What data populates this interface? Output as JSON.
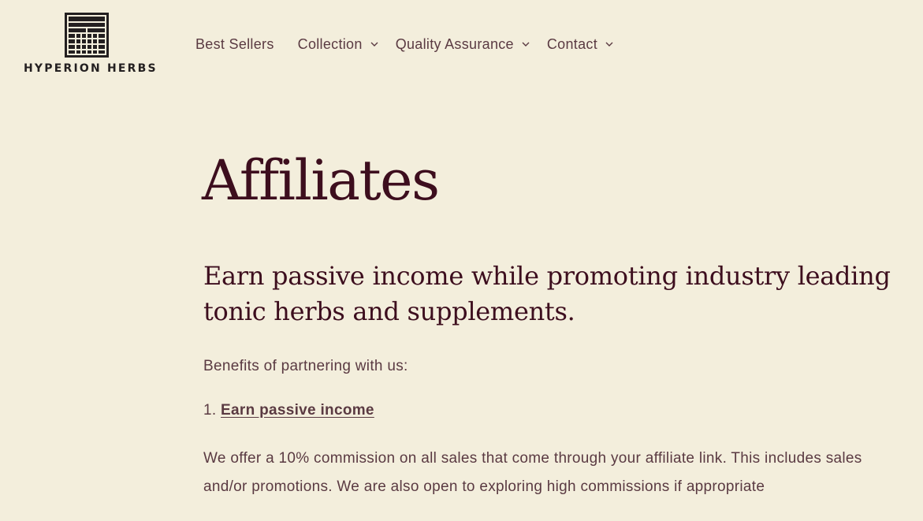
{
  "brand": {
    "name": "HYPERION HERBS",
    "logo_icon": "barcode-grid-logo-icon"
  },
  "nav": {
    "items": [
      {
        "label": "Best Sellers",
        "has_dropdown": false
      },
      {
        "label": "Collection",
        "has_dropdown": true
      },
      {
        "label": "Quality Assurance",
        "has_dropdown": true
      },
      {
        "label": "Contact",
        "has_dropdown": true
      }
    ]
  },
  "page": {
    "title": "Affiliates",
    "subtitle": "Earn passive income while promoting industry leading tonic herbs and supplements.",
    "benefits_intro": "Benefits of partnering with us:",
    "list": [
      {
        "number": "1.",
        "link_label": "Earn passive income"
      }
    ],
    "paragraph": "We offer a 10% commission on all sales that come through your affiliate link. This includes sales and/or promotions. We are also open to exploring high commissions if appropriate"
  },
  "colors": {
    "background": "#f3eedc",
    "heading": "#3d0e1e",
    "body_text": "#5a3a42",
    "logo": "#231f20"
  }
}
